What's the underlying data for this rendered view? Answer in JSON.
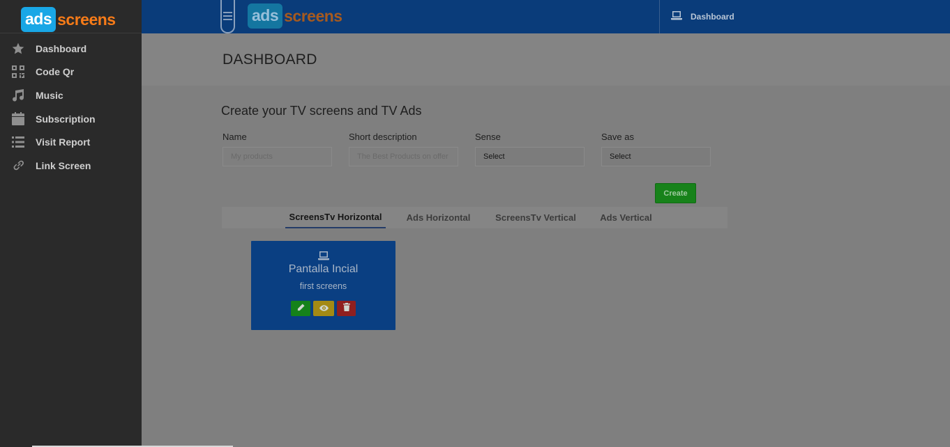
{
  "brand": {
    "logo_ads": "ads",
    "logo_screens": "screens"
  },
  "sidebar": {
    "items": [
      {
        "label": "Dashboard",
        "icon": "star-icon"
      },
      {
        "label": "Code Qr",
        "icon": "qrcode-icon"
      },
      {
        "label": "Music",
        "icon": "music-icon"
      },
      {
        "label": "Subscription",
        "icon": "calendar-icon"
      },
      {
        "label": "Visit Report",
        "icon": "list-icon"
      },
      {
        "label": "Link Screen",
        "icon": "link-icon"
      }
    ]
  },
  "topbar": {
    "dashboard_label": "Dashboard",
    "dashboard_icon": "laptop-icon"
  },
  "page": {
    "title": "DASHBOARD"
  },
  "form": {
    "heading": "Create your TV screens and TV Ads",
    "name": {
      "label": "Name",
      "placeholder": "My products"
    },
    "description": {
      "label": "Short description",
      "placeholder": "The Best Products on offer"
    },
    "sense": {
      "label": "Sense",
      "value": "Select"
    },
    "save_as": {
      "label": "Save as",
      "value": "Select"
    },
    "create_label": "Create"
  },
  "tabs": [
    {
      "label": "ScreensTv Horizontal",
      "active": true
    },
    {
      "label": "Ads Horizontal",
      "active": false
    },
    {
      "label": "ScreensTv Vertical",
      "active": false
    },
    {
      "label": "Ads Vertical",
      "active": false
    }
  ],
  "cards": [
    {
      "title": "Pantalla Incial",
      "subtitle": "first screens",
      "icon": "laptop-icon"
    }
  ],
  "colors": {
    "sidebar_bg": "#2a2a2a",
    "topbar_bg": "#0a3c7a",
    "card_bg": "#0a3f82",
    "create_button": "#17821a",
    "edit_button": "#15821a",
    "view_button": "#a48a14",
    "delete_button": "#8f1f1f",
    "logo_ads": "#19a7e6",
    "logo_screens": "#f77b18"
  }
}
